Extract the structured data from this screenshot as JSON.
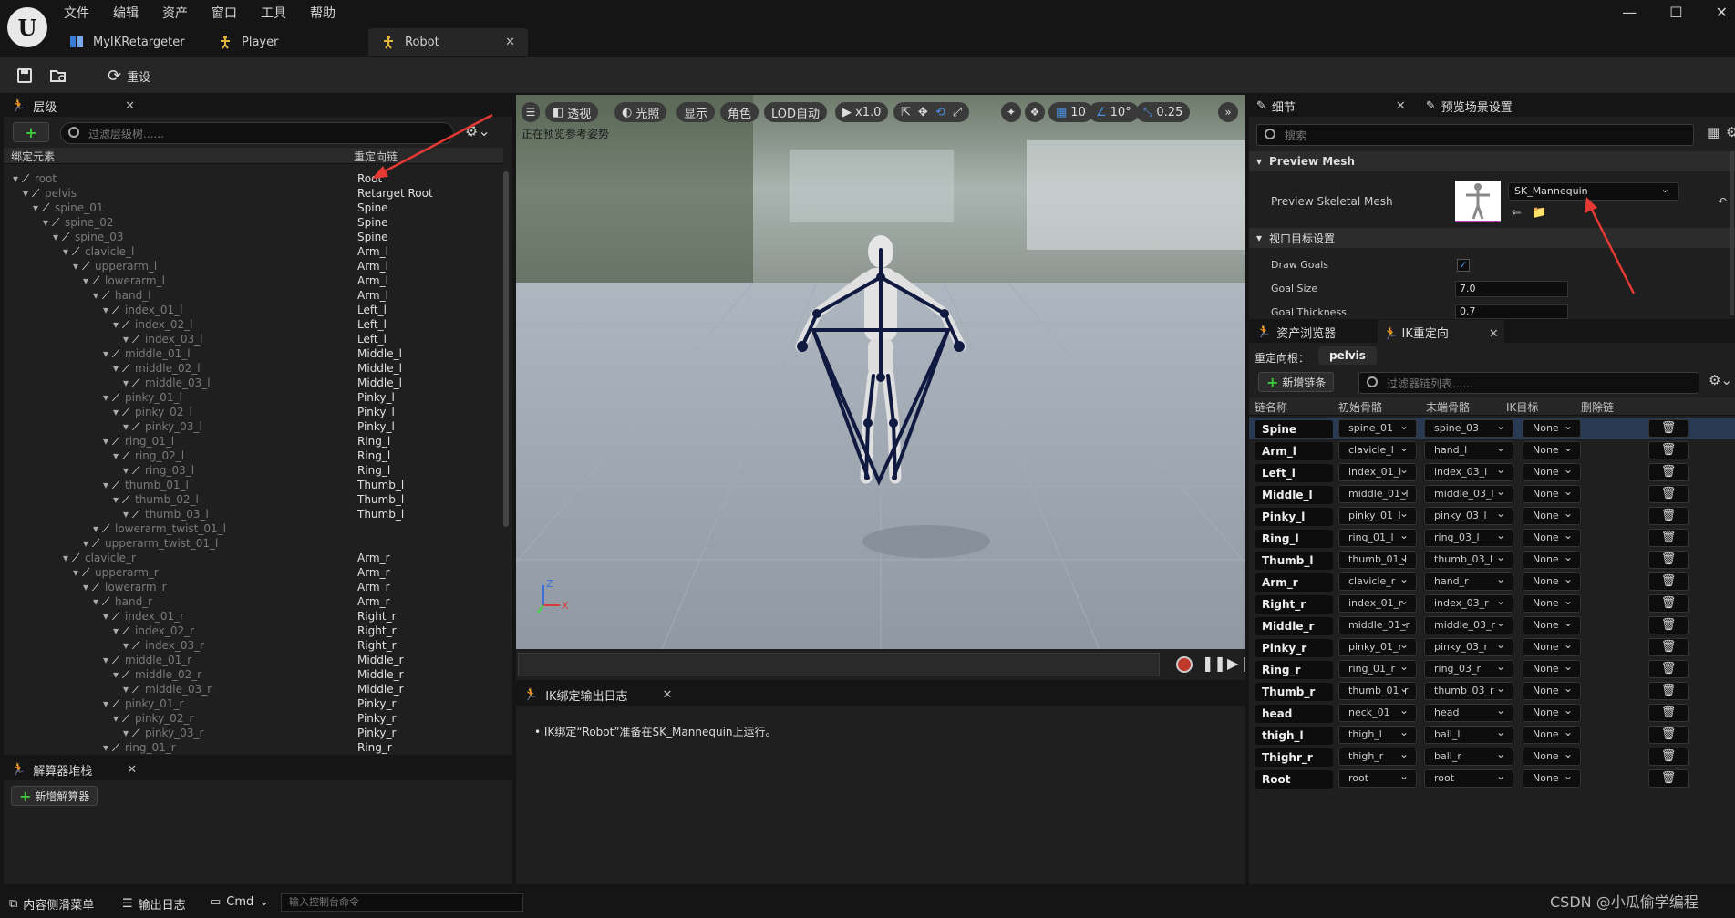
{
  "menu": [
    "文件",
    "编辑",
    "资产",
    "窗口",
    "工具",
    "帮助"
  ],
  "tabs": [
    {
      "label": "MyIKRetargeter"
    },
    {
      "label": "Player"
    },
    {
      "label": "Robot"
    }
  ],
  "toolbar": {
    "reset": "重设"
  },
  "hierarchy": {
    "title": "层级",
    "filter_placeholder": "过滤层级树......",
    "col_bone": "绑定元素",
    "col_chain": "重定向链",
    "rows": [
      {
        "name": "root",
        "chain": "Root",
        "depth": 0
      },
      {
        "name": "pelvis",
        "chain": "Retarget Root",
        "depth": 1
      },
      {
        "name": "spine_01",
        "chain": "Spine",
        "depth": 2
      },
      {
        "name": "spine_02",
        "chain": "Spine",
        "depth": 3
      },
      {
        "name": "spine_03",
        "chain": "Spine",
        "depth": 4
      },
      {
        "name": "clavicle_l",
        "chain": "Arm_l",
        "depth": 5
      },
      {
        "name": "upperarm_l",
        "chain": "Arm_l",
        "depth": 6
      },
      {
        "name": "lowerarm_l",
        "chain": "Arm_l",
        "depth": 7
      },
      {
        "name": "hand_l",
        "chain": "Arm_l",
        "depth": 8
      },
      {
        "name": "index_01_l",
        "chain": "Left_l",
        "depth": 9
      },
      {
        "name": "index_02_l",
        "chain": "Left_l",
        "depth": 10
      },
      {
        "name": "index_03_l",
        "chain": "Left_l",
        "depth": 11
      },
      {
        "name": "middle_01_l",
        "chain": "Middle_l",
        "depth": 9
      },
      {
        "name": "middle_02_l",
        "chain": "Middle_l",
        "depth": 10
      },
      {
        "name": "middle_03_l",
        "chain": "Middle_l",
        "depth": 11
      },
      {
        "name": "pinky_01_l",
        "chain": "Pinky_l",
        "depth": 9
      },
      {
        "name": "pinky_02_l",
        "chain": "Pinky_l",
        "depth": 10
      },
      {
        "name": "pinky_03_l",
        "chain": "Pinky_l",
        "depth": 11
      },
      {
        "name": "ring_01_l",
        "chain": "Ring_l",
        "depth": 9
      },
      {
        "name": "ring_02_l",
        "chain": "Ring_l",
        "depth": 10
      },
      {
        "name": "ring_03_l",
        "chain": "Ring_l",
        "depth": 11
      },
      {
        "name": "thumb_01_l",
        "chain": "Thumb_l",
        "depth": 9
      },
      {
        "name": "thumb_02_l",
        "chain": "Thumb_l",
        "depth": 10
      },
      {
        "name": "thumb_03_l",
        "chain": "Thumb_l",
        "depth": 11
      },
      {
        "name": "lowerarm_twist_01_l",
        "chain": "",
        "depth": 8
      },
      {
        "name": "upperarm_twist_01_l",
        "chain": "",
        "depth": 7
      },
      {
        "name": "clavicle_r",
        "chain": "Arm_r",
        "depth": 5
      },
      {
        "name": "upperarm_r",
        "chain": "Arm_r",
        "depth": 6
      },
      {
        "name": "lowerarm_r",
        "chain": "Arm_r",
        "depth": 7
      },
      {
        "name": "hand_r",
        "chain": "Arm_r",
        "depth": 8
      },
      {
        "name": "index_01_r",
        "chain": "Right_r",
        "depth": 9
      },
      {
        "name": "index_02_r",
        "chain": "Right_r",
        "depth": 10
      },
      {
        "name": "index_03_r",
        "chain": "Right_r",
        "depth": 11
      },
      {
        "name": "middle_01_r",
        "chain": "Middle_r",
        "depth": 9
      },
      {
        "name": "middle_02_r",
        "chain": "Middle_r",
        "depth": 10
      },
      {
        "name": "middle_03_r",
        "chain": "Middle_r",
        "depth": 11
      },
      {
        "name": "pinky_01_r",
        "chain": "Pinky_r",
        "depth": 9
      },
      {
        "name": "pinky_02_r",
        "chain": "Pinky_r",
        "depth": 10
      },
      {
        "name": "pinky_03_r",
        "chain": "Pinky_r",
        "depth": 11
      },
      {
        "name": "ring_01_r",
        "chain": "Ring_r",
        "depth": 9
      }
    ]
  },
  "solver": {
    "title": "解算器堆栈",
    "add": "新增解算器"
  },
  "viewport": {
    "menu_icon": "hamburger-icon",
    "perspective": "透视",
    "lit": "光照",
    "show": "显示",
    "character": "角色",
    "lod": "LOD自动",
    "speed": "x1.0",
    "grid": "10",
    "angle": "10°",
    "scale": "0.25",
    "hint": "正在预览参考姿势"
  },
  "log": {
    "title": "IK绑定输出日志",
    "message": "IK绑定“Robot”准备在SK_Mannequin上运行。"
  },
  "details": {
    "tab1": "细节",
    "tab2": "预览场景设置",
    "search": "搜索",
    "section1": "Preview Mesh",
    "mesh_label": "Preview Skeletal Mesh",
    "mesh_value": "SK_Mannequin",
    "section2": "视口目标设置",
    "draw_goals": "Draw Goals",
    "goal_size": "Goal Size",
    "goal_size_value": "7.0",
    "goal_thickness": "Goal Thickness",
    "goal_thickness_value": "0.7"
  },
  "ik": {
    "tab1": "资产浏览器",
    "tab2": "IK重定向",
    "root_label": "重定向根：",
    "root_value": "pelvis",
    "add_chain": "新增链条",
    "filter": "过滤器链列表......",
    "cols": [
      "链名称",
      "初始骨骼",
      "末端骨骼",
      "IK目标",
      "删除链"
    ],
    "rows": [
      {
        "name": "Spine",
        "start": "spine_01",
        "end": "spine_03",
        "goal": "None"
      },
      {
        "name": "Arm_l",
        "start": "clavicle_l",
        "end": "hand_l",
        "goal": "None"
      },
      {
        "name": "Left_l",
        "start": "index_01_l",
        "end": "index_03_l",
        "goal": "None"
      },
      {
        "name": "Middle_l",
        "start": "middle_01_l",
        "end": "middle_03_l",
        "goal": "None"
      },
      {
        "name": "Pinky_l",
        "start": "pinky_01_l",
        "end": "pinky_03_l",
        "goal": "None"
      },
      {
        "name": "Ring_l",
        "start": "ring_01_l",
        "end": "ring_03_l",
        "goal": "None"
      },
      {
        "name": "Thumb_l",
        "start": "thumb_01_l",
        "end": "thumb_03_l",
        "goal": "None"
      },
      {
        "name": "Arm_r",
        "start": "clavicle_r",
        "end": "hand_r",
        "goal": "None"
      },
      {
        "name": "Right_r",
        "start": "index_01_r",
        "end": "index_03_r",
        "goal": "None"
      },
      {
        "name": "Middle_r",
        "start": "middle_01_r",
        "end": "middle_03_r",
        "goal": "None"
      },
      {
        "name": "Pinky_r",
        "start": "pinky_01_r",
        "end": "pinky_03_r",
        "goal": "None"
      },
      {
        "name": "Ring_r",
        "start": "ring_01_r",
        "end": "ring_03_r",
        "goal": "None"
      },
      {
        "name": "Thumb_r",
        "start": "thumb_01_r",
        "end": "thumb_03_r",
        "goal": "None"
      },
      {
        "name": "head",
        "start": "neck_01",
        "end": "head",
        "goal": "None"
      },
      {
        "name": "thigh_l",
        "start": "thigh_l",
        "end": "ball_l",
        "goal": "None"
      },
      {
        "name": "Thighr_r",
        "start": "thigh_r",
        "end": "ball_r",
        "goal": "None"
      },
      {
        "name": "Root",
        "start": "root",
        "end": "root",
        "goal": "None"
      }
    ]
  },
  "status": {
    "drawer": "内容侧滑菜单",
    "output": "输出日志",
    "cmd": "Cmd",
    "console": "输入控制台命令",
    "watermark": "CSDN @小瓜偷学编程"
  },
  "colors": {
    "accent": "#3a7bd5",
    "annotation": "#e53935",
    "selected_row": "#2a3a52"
  }
}
